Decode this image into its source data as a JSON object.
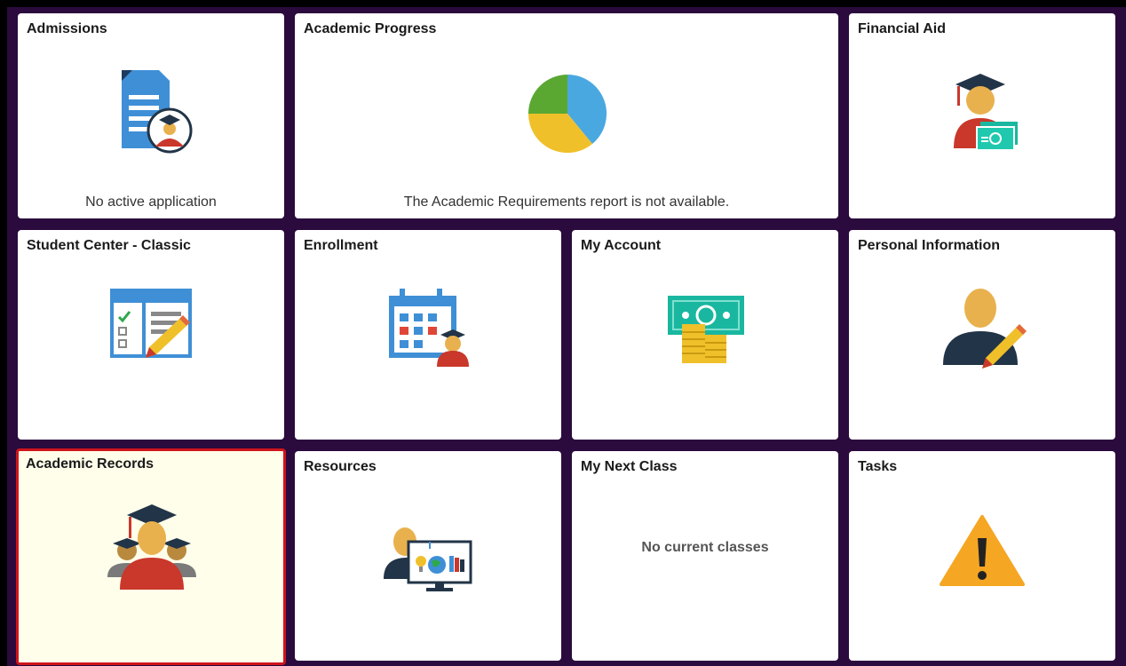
{
  "tiles": {
    "admissions": {
      "title": "Admissions",
      "status": "No active application",
      "icon": "application-document-icon"
    },
    "academic_progress": {
      "title": "Academic Progress",
      "status": "The Academic Requirements report is not available.",
      "icon": "pie-chart-icon"
    },
    "financial_aid": {
      "title": "Financial Aid",
      "icon": "graduate-money-icon"
    },
    "student_center": {
      "title": "Student Center - Classic",
      "icon": "checklist-pencil-icon"
    },
    "enrollment": {
      "title": "Enrollment",
      "icon": "calendar-graduate-icon"
    },
    "my_account": {
      "title": "My Account",
      "icon": "cash-coins-icon"
    },
    "personal_information": {
      "title": "Personal Information",
      "icon": "person-pencil-icon"
    },
    "academic_records": {
      "title": "Academic Records",
      "icon": "graduates-group-icon",
      "selected": true
    },
    "resources": {
      "title": "Resources",
      "icon": "person-monitor-icon"
    },
    "my_next_class": {
      "title": "My Next Class",
      "status": "No current classes"
    },
    "tasks": {
      "title": "Tasks",
      "icon": "warning-icon"
    }
  },
  "colors": {
    "background": "#2b0a3d",
    "tile": "#ffffff",
    "selected_tile": "#fffeea",
    "selected_border": "#d0141b",
    "doc_blue": "#3f8fd6",
    "cap_navy": "#223447",
    "skin": "#e8b14d",
    "robe_red": "#c9382b",
    "money_green": "#1ab7a0",
    "coin_gold": "#f0c02a",
    "warning_orange": "#f5a623"
  }
}
